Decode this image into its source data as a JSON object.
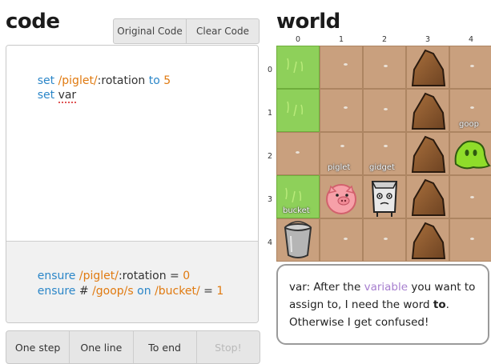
{
  "code_panel": {
    "title": "code",
    "buttons": {
      "original": "Original Code",
      "clear": "Clear Code"
    },
    "code_lines": [
      {
        "kw": "set",
        "target": "/piglet/",
        "prop": ":rotation",
        "to": "to",
        "value": "5"
      },
      {
        "kw": "set",
        "rest": "var"
      }
    ],
    "goals": [
      {
        "kw": "ensure",
        "target": "/piglet/",
        "rest": ":rotation = ",
        "value": "0"
      },
      {
        "kw": "ensure",
        "prefix": " # ",
        "target": "/goop/s",
        "op": "on",
        "target2": "/bucket/",
        "rest": " = ",
        "value": "1"
      }
    ],
    "controls": [
      "One step",
      "One line",
      "To end",
      "Stop!"
    ]
  },
  "world_panel": {
    "title": "world",
    "columns": [
      "0",
      "1",
      "2",
      "3",
      "4"
    ],
    "rows": [
      "0",
      "1",
      "2",
      "3",
      "4"
    ],
    "labels": {
      "piglet": "piglet",
      "gidget": "gidget",
      "goop": "goop",
      "bucket": "bucket"
    },
    "message": {
      "part1": "var: After the ",
      "highlight": "variable",
      "part2": " you want to assign to, I need the word ",
      "bold": "to",
      "part3": ". Otherwise I get confused!"
    }
  },
  "colors": {
    "keyword": "#2b86c8",
    "string": "#e07a10",
    "dirt": "#c9a07e",
    "grass": "#8ed05a"
  }
}
